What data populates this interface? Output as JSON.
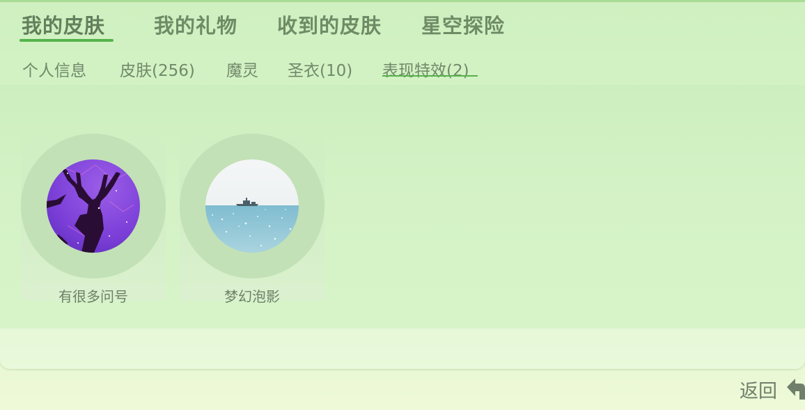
{
  "main_tabs": [
    {
      "label": "我的皮肤",
      "active": true
    },
    {
      "label": "我的礼物",
      "active": false
    },
    {
      "label": "收到的皮肤",
      "active": false
    },
    {
      "label": "星空探险",
      "active": false
    }
  ],
  "sub_tabs": [
    {
      "label": "个人信息",
      "active": false
    },
    {
      "label": "皮肤(256)",
      "active": false
    },
    {
      "label": "魔灵",
      "active": false
    },
    {
      "label": "圣衣(10)",
      "active": false
    },
    {
      "label": "表现特效(2)",
      "active": true
    }
  ],
  "effects": [
    {
      "name": "有很多问号",
      "image": "purple-deer-silhouette"
    },
    {
      "name": "梦幻泡影",
      "image": "ship-on-sea"
    }
  ],
  "footer": {
    "back_label": "返回",
    "back_icon": "back-arrow-icon"
  },
  "colors": {
    "accent": "#55b34b",
    "text": "#6f8b66",
    "ring": "#c2e1b6"
  }
}
